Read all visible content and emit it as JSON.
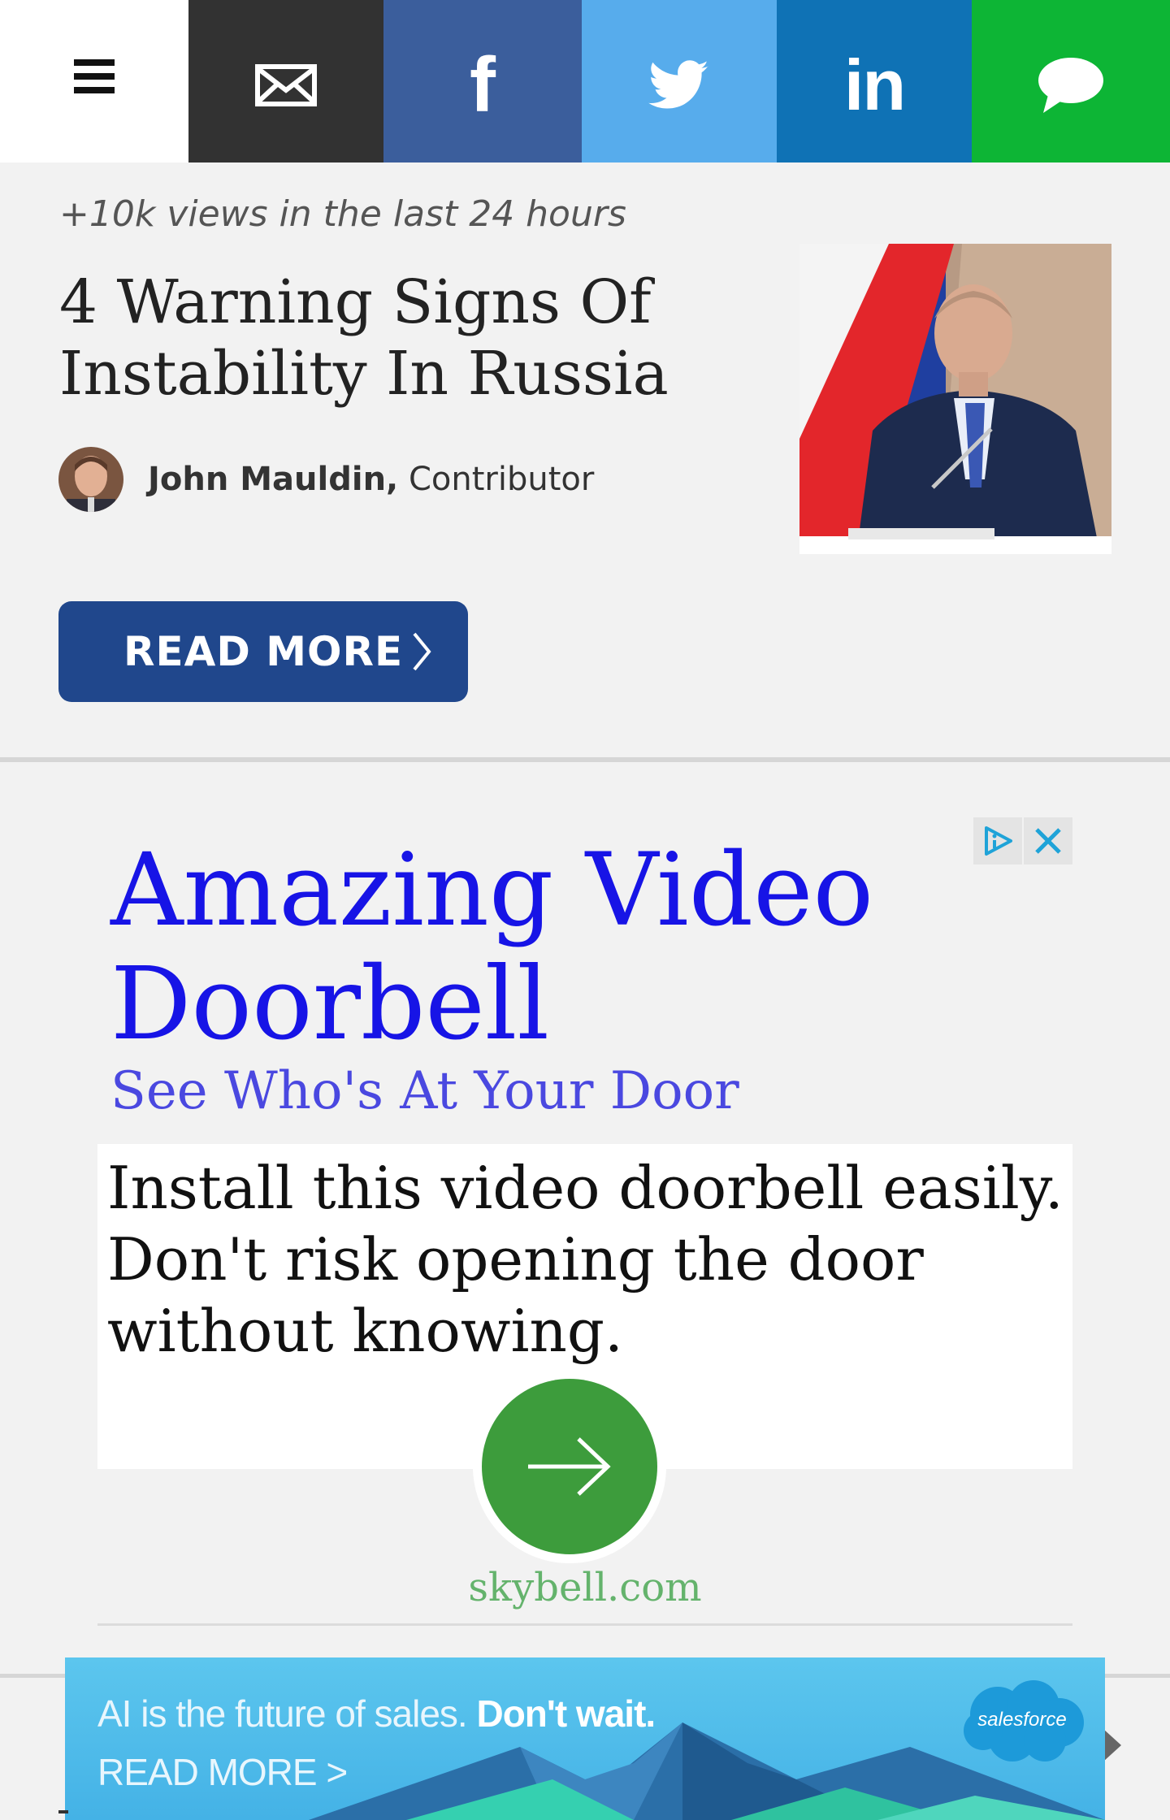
{
  "share_bar": {
    "items": [
      {
        "name": "menu",
        "icon": "hamburger-icon",
        "color": "#ffffff"
      },
      {
        "name": "email",
        "icon": "envelope-icon",
        "color": "#323232"
      },
      {
        "name": "facebook",
        "icon": "facebook-icon",
        "glyph": "f",
        "color": "#3b5e9c"
      },
      {
        "name": "twitter",
        "icon": "twitter-bird-icon",
        "color": "#57acec"
      },
      {
        "name": "linkedin",
        "icon": "linkedin-icon",
        "glyph": "in",
        "color": "#0f72b5"
      },
      {
        "name": "sms",
        "icon": "speech-bubble-icon",
        "color": "#0db535"
      }
    ]
  },
  "article": {
    "views": "+10k views in the last 24 hours",
    "title": "4 Warning Signs Of Instability In Russia",
    "author_name": "John Mauldin,",
    "author_role": "Contributor",
    "read_more": "READ MORE"
  },
  "ad": {
    "headline": "Amazing Video Doorbell",
    "subheadline": "See Who's At Your Door",
    "body": "Install this video doorbell easily. Don't risk opening the door without knowing.",
    "domain": "skybell.com",
    "colors": {
      "headline": "#1714e6",
      "cta": "#3d9c3c",
      "domain": "#64b36c"
    }
  },
  "banner": {
    "line1_light": "AI is the future of sales.",
    "line1_bold": "Don't wait.",
    "line2": "READ MORE >",
    "logo": "salesforce"
  }
}
